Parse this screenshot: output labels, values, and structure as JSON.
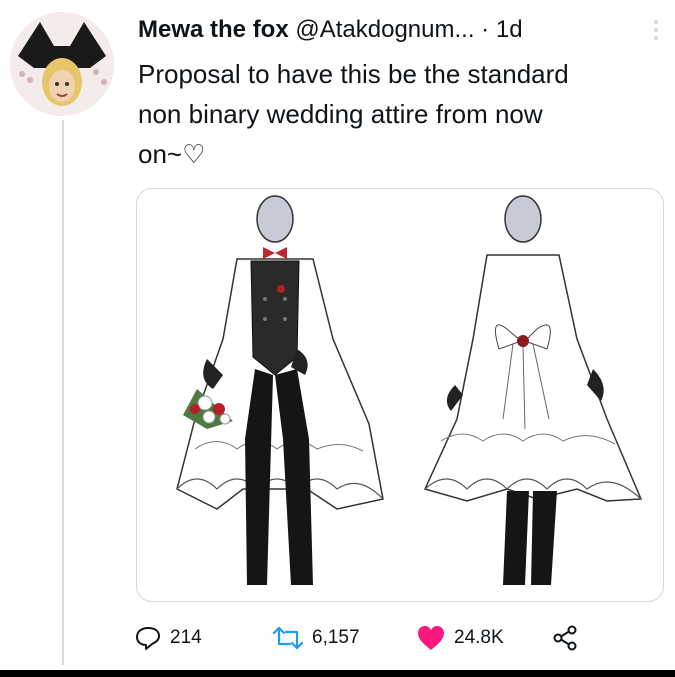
{
  "tweet": {
    "display_name": "Mewa the fox",
    "handle": "@Atakdognum...",
    "separator": "·",
    "time": "1d",
    "text": "Proposal to have this be the standard\nnon binary wedding attire from now\non~♡",
    "media": {
      "description_icon": "wedding-outfit-illustration"
    },
    "actions": {
      "replies": "214",
      "retweets": "6,157",
      "likes": "24.8K"
    },
    "colors": {
      "like": "#f91880",
      "text": "#0f1419",
      "border": "#cfd9de",
      "retweet": "#1d9bf0"
    }
  }
}
